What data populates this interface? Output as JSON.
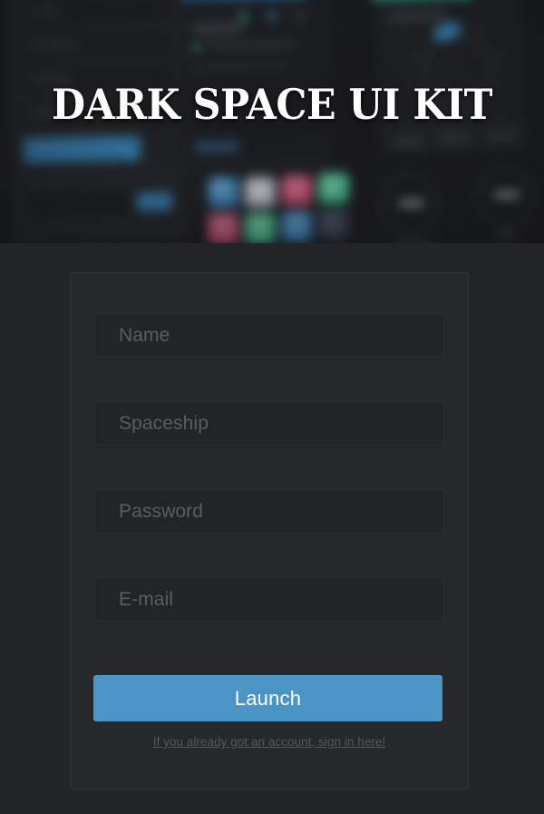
{
  "hero": {
    "title": "DARK SPACE UI KIT",
    "artwork": {
      "description": "blurred dark-ui kit screenshots behind the title",
      "accent_blue": "#3d93d0",
      "accent_teal": "#32c9a4",
      "tiles": [
        {
          "name": "tile-blue",
          "color": "#4aa3dd"
        },
        {
          "name": "tile-white",
          "color": "#dfe3e8"
        },
        {
          "name": "tile-pink",
          "color": "#e0567f"
        },
        {
          "name": "tile-green",
          "color": "#4bd49b"
        },
        {
          "name": "tile-pink-2",
          "color": "#e0567f"
        },
        {
          "name": "tile-green-2",
          "color": "#4bd49b"
        },
        {
          "name": "tile-blue-2",
          "color": "#3e93d4"
        },
        {
          "name": "tile-slate",
          "color": "#3c4658"
        }
      ]
    }
  },
  "form": {
    "fields": [
      {
        "name": "name",
        "placeholder": "Name",
        "value": "",
        "type": "text"
      },
      {
        "name": "spaceship",
        "placeholder": "Spaceship",
        "value": "",
        "type": "text"
      },
      {
        "name": "password",
        "placeholder": "Password",
        "value": "",
        "type": "password"
      },
      {
        "name": "email",
        "placeholder": "E-mail",
        "value": "",
        "type": "text"
      }
    ],
    "submit_label": "Launch",
    "submit_color": "#4a94c6",
    "signin_link": "If you already got an account, sign in here!"
  },
  "theme": {
    "page_background": "#232427",
    "card_background": "#26282c",
    "input_background": "#222427",
    "placeholder_color": "#5a5d63",
    "link_color": "#54575c",
    "title_color": "#ffffff"
  }
}
